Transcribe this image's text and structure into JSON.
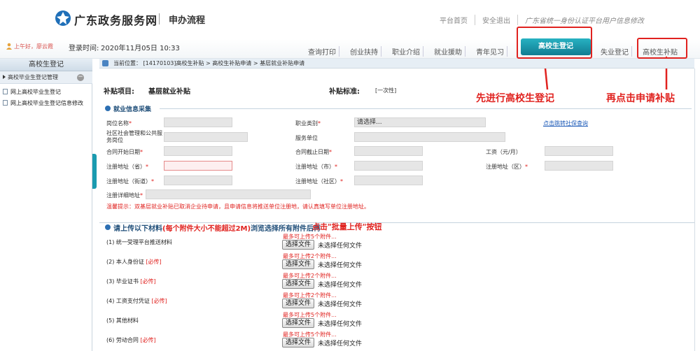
{
  "header": {
    "site_title": "广东政务服务网",
    "subtitle": "申办流程",
    "top_links": [
      "平台首页",
      "安全退出",
      "广东省统一身份认证平台用户信息修改"
    ]
  },
  "userbar": {
    "greeting": "上午好，廖云霞",
    "login_label": "登录时间:",
    "login_time": "2020年11月05日 10:33"
  },
  "nav_tabs": [
    "查询打印",
    "创业扶持",
    "职业介绍",
    "就业援助",
    "青年见习",
    "高校生登记",
    "失业登记",
    "高校生补贴"
  ],
  "annotations": {
    "step1": "先进行高校生登记",
    "step2": "再点击申请补贴",
    "upload_tip": "点击\"批量上传\"按钮"
  },
  "sidebar": {
    "title": "高校生登记",
    "group": "高校毕业生登记管理",
    "items": [
      "网上高校毕业生登记",
      "网上高校毕业生登记信息修改"
    ]
  },
  "breadcrumb": "当前位置： [14170103]高校生补贴 > 高校生补贴申请 > 基层就业补贴申请",
  "subsidy": {
    "item_label": "补贴项目:",
    "item_value": "基层就业补贴",
    "standard_label": "补贴标准:",
    "standard_value": "[一次性]"
  },
  "employment": {
    "section_title": "就业信息采集",
    "fields": {
      "position_name": "岗位名称",
      "job_category": "职业类别",
      "job_category_value": "请选择...",
      "community_post": "社区社会管理和公共服务岗位",
      "service_unit": "服务单位",
      "contract_start": "合同开始日期",
      "contract_end": "合同截止日期",
      "salary": "工资（元/月）",
      "reg_province": "注册地址（省）",
      "reg_city": "注册地址（市）",
      "reg_district": "注册地址（区）",
      "reg_street": "注册地址（街道）",
      "reg_community": "注册地址（社区）",
      "reg_detail": "注册详细地址"
    },
    "social_link": "点击跳转社保查询",
    "warm_tip": "温馨提示：双基层就业补贴已取消企业待申请，且申请信息将推送单位注册地，请认真填写单位注册地址。"
  },
  "upload": {
    "section_title_1": "请上传以下材料",
    "section_title_2": "(每个附件大小不能超过2M)",
    "section_title_3": "浏览选择所有附件后再",
    "choose_label": "选择文件",
    "none_label": "未选择任何文件",
    "required": "[必传]",
    "items": [
      {
        "label": "(1) 统一受理平台推送材料",
        "hint": "最多可上传5个附件...",
        "required": false
      },
      {
        "label": "(2) 本人身份证",
        "hint": "最多可上传2个附件...",
        "required": true
      },
      {
        "label": "(3) 毕业证书",
        "hint": "最多可上传2个附件...",
        "required": true
      },
      {
        "label": "(4) 工资支付凭证",
        "hint": "最多可上传2个附件...",
        "required": true
      },
      {
        "label": "(5) 其他材料",
        "hint": "最多可上传5个附件...",
        "required": false
      },
      {
        "label": "(6) 劳动合同",
        "hint": "最多可上传5个附件...",
        "required": true
      }
    ]
  }
}
